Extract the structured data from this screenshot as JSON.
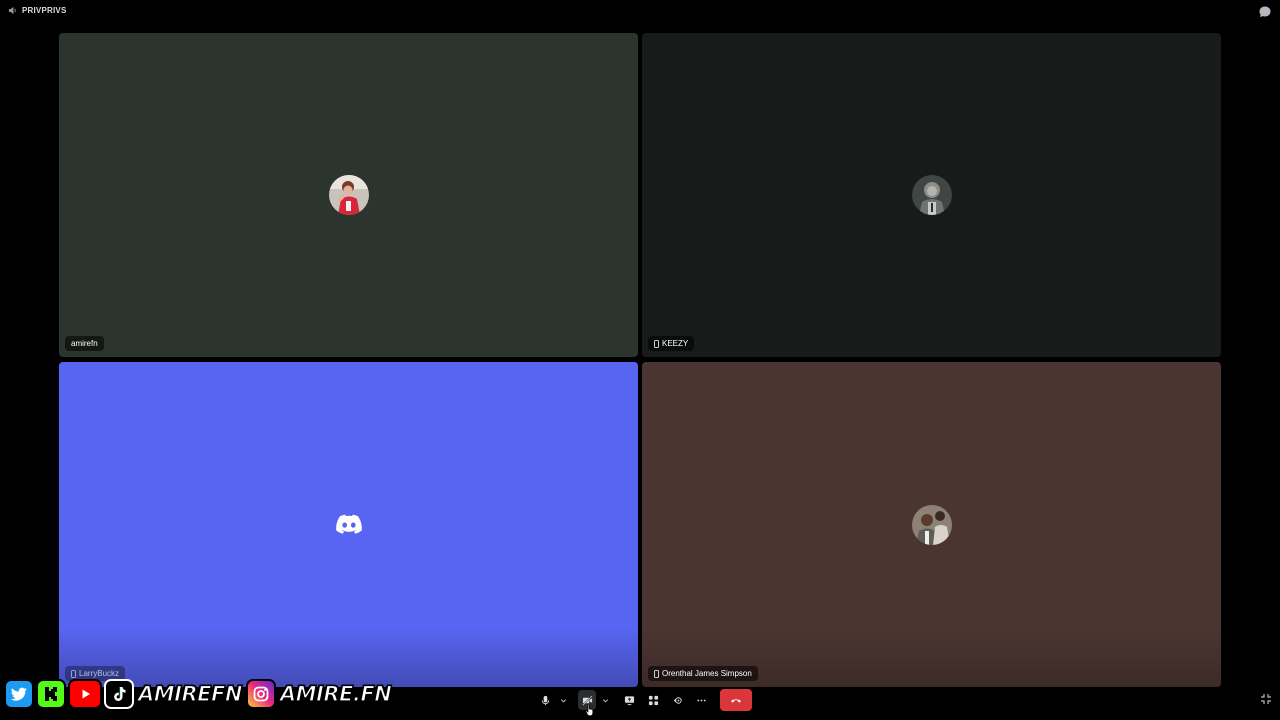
{
  "window": {
    "channel_name": "PRIVPRIVS"
  },
  "participants": [
    {
      "name": "amirefn",
      "avatar": "avatar-photo",
      "tile_color": "#2b352e",
      "mobile": false
    },
    {
      "name": "KEEZY",
      "avatar": "avatar-photo",
      "tile_color": "#181b1a",
      "mobile": true
    },
    {
      "name": "LarryBuckz",
      "avatar": "discord-default-icon",
      "tile_color": "#5865f2",
      "mobile": true
    },
    {
      "name": "Orenthal James Simpson",
      "avatar": "avatar-photo",
      "tile_color": "#4b3531",
      "mobile": true
    }
  ],
  "controls": {
    "items": [
      "microphone-icon",
      "chevron-down-icon",
      "camera-off-icon",
      "chevron-down-icon",
      "screen-share-icon",
      "activities-icon",
      "soundboard-icon",
      "more-icon",
      "hang-up-icon"
    ],
    "hangup_color": "#da373c"
  },
  "overlay": {
    "socials": [
      "twitter-icon",
      "kick-icon",
      "youtube-icon",
      "tiktok-icon",
      "instagram-icon"
    ],
    "handle_1": "AMIREFN",
    "handle_2": "AMIRE.FN"
  }
}
